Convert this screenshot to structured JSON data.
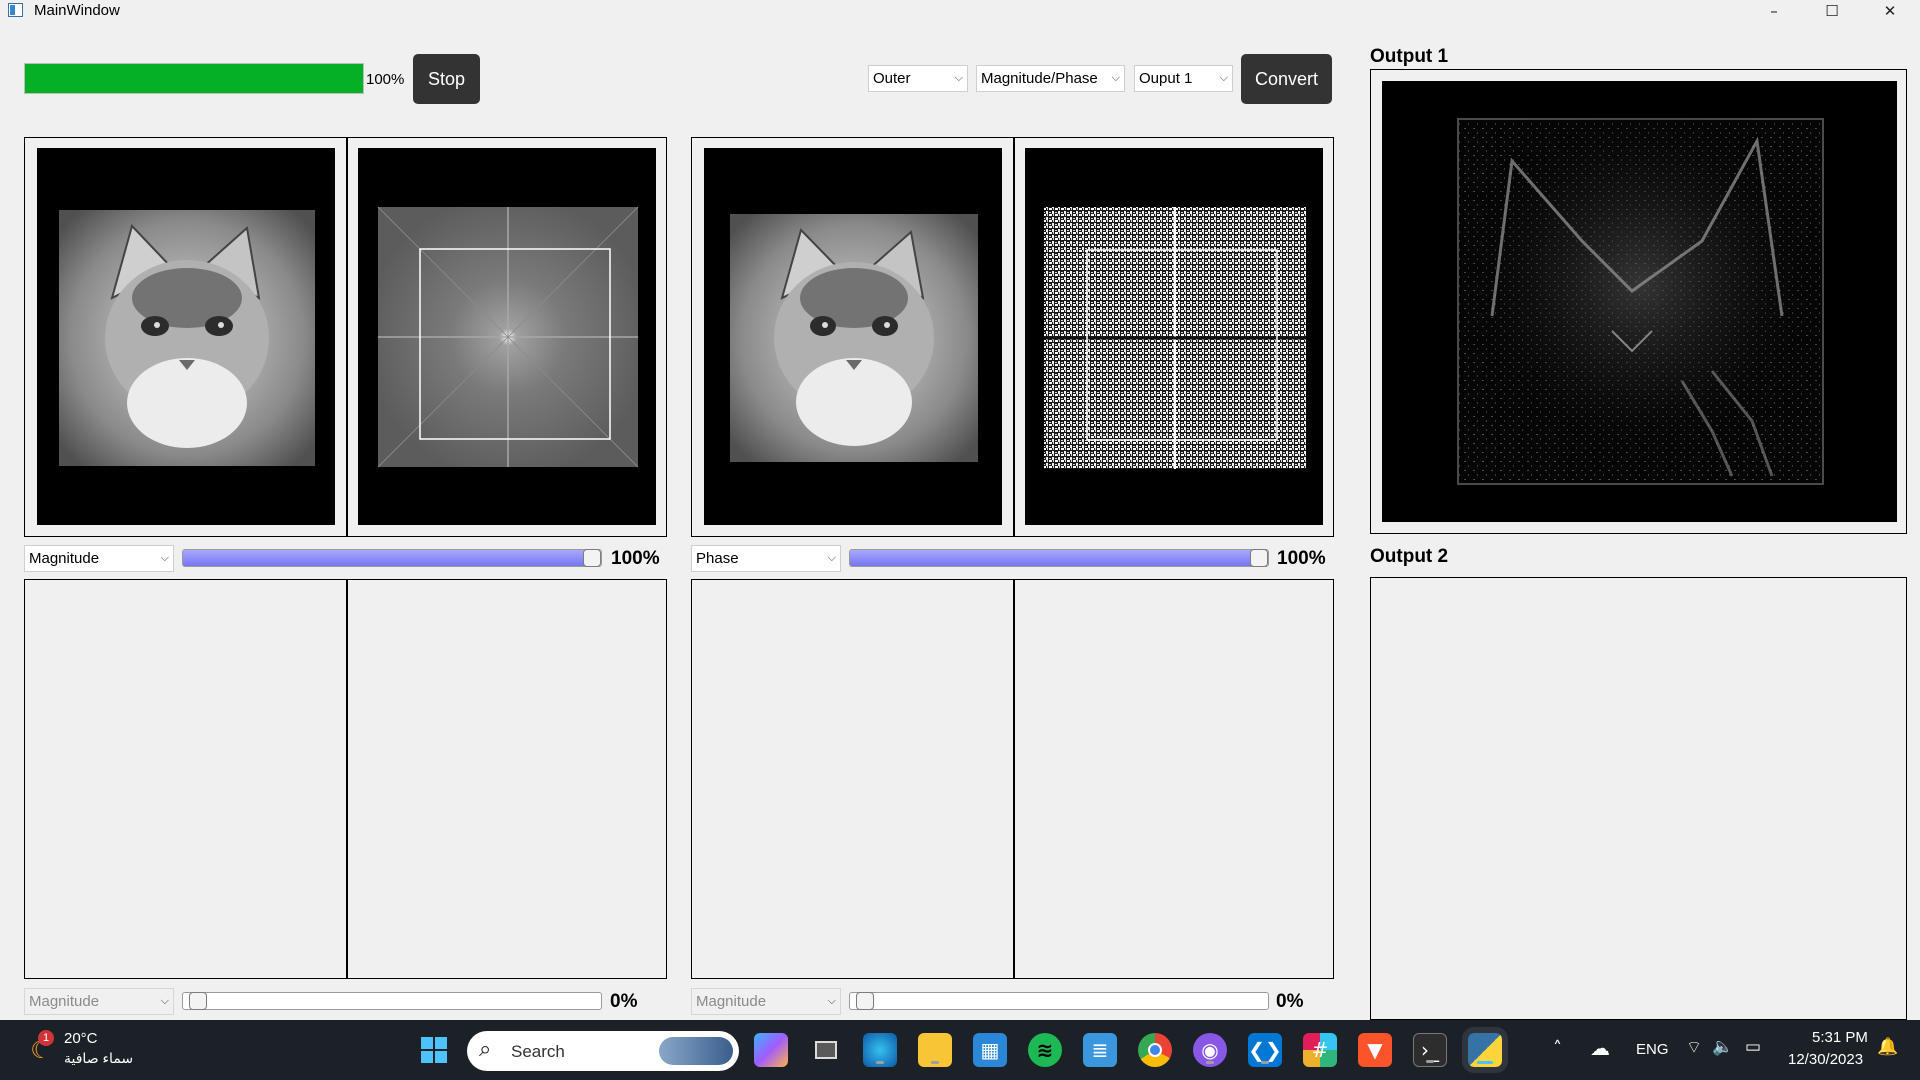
{
  "window": {
    "title": "MainWindow",
    "controls": [
      "–",
      "☐",
      "✕"
    ]
  },
  "toolbar": {
    "progress_value": 1.0,
    "progress_label": "100%",
    "stop_label": "Stop",
    "region_select": "Outer",
    "mode_select": "Magnitude/Phase",
    "output_select": "Ouput 1",
    "convert_label": "Convert"
  },
  "image_panels": [
    {
      "component": "Magnitude",
      "weight_value": 1.0,
      "weight_label": "100%",
      "has_image": true,
      "ft_type": "magnitude"
    },
    {
      "component": "Phase",
      "weight_value": 1.0,
      "weight_label": "100%",
      "has_image": true,
      "ft_type": "phase"
    },
    {
      "component": "Magnitude",
      "weight_value": 0.0,
      "weight_label": "0%",
      "has_image": false
    },
    {
      "component": "Magnitude",
      "weight_value": 0.0,
      "weight_label": "0%",
      "has_image": false
    }
  ],
  "outputs": {
    "output1_label": "Output 1",
    "output2_label": "Output 2"
  },
  "taskbar": {
    "weather_temp": "20°C",
    "weather_desc": "سماء صافية",
    "weather_badge": "1",
    "search_placeholder": "Search",
    "apps": [
      "windows-start",
      "copilot",
      "task-view",
      "edge",
      "file-explorer",
      "store",
      "spotify",
      "notepad",
      "chrome",
      "github",
      "vscode",
      "slack",
      "brave",
      "terminal",
      "python"
    ],
    "language": "ENG",
    "time": "5:31 PM",
    "date": "12/30/2023"
  },
  "colors": {
    "progress_green": "#06b025",
    "button_dark": "#333333",
    "slider_blue": "#7676f0",
    "taskbar_bg": "#1c2128"
  }
}
